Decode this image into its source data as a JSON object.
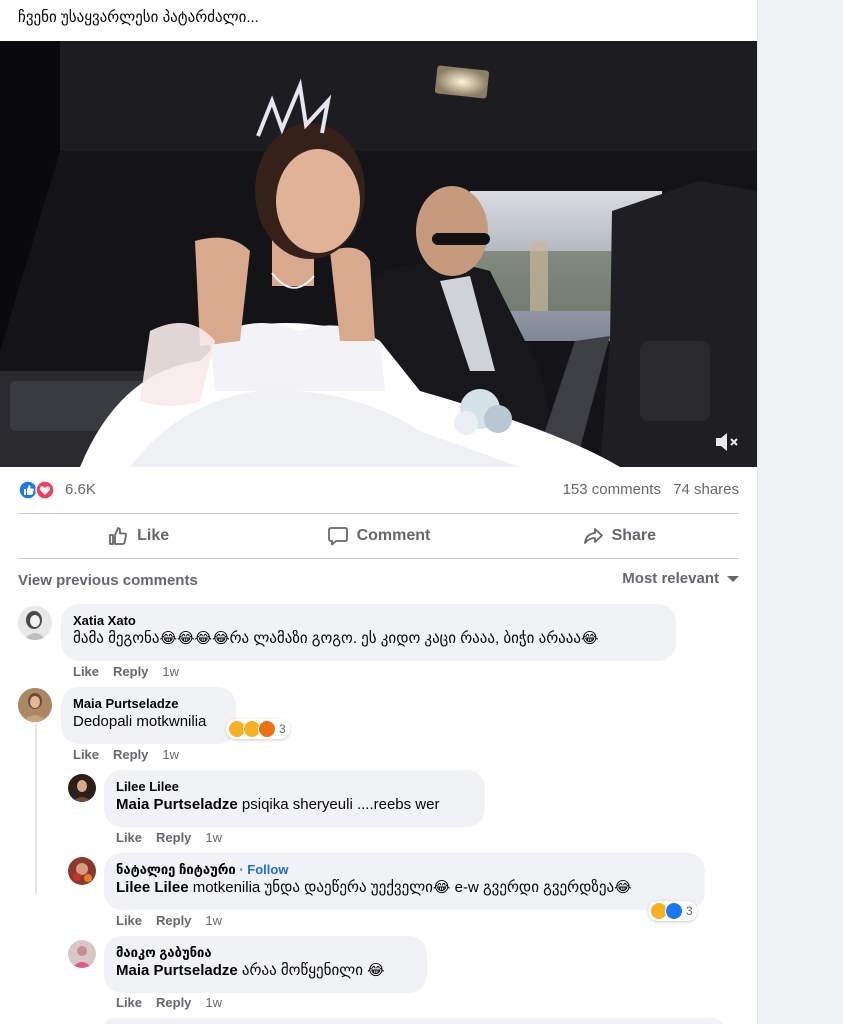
{
  "post": {
    "caption": "ჩვენი უსაყვარლესი პატარძალი..."
  },
  "stats": {
    "reactions_count": "6.6K",
    "comments": "153 comments",
    "shares": "74 shares"
  },
  "actions": {
    "like": "Like",
    "comment": "Comment",
    "share": "Share"
  },
  "comments_header": {
    "view_previous": "View previous comments",
    "sort": "Most relevant"
  },
  "comments": [
    {
      "author": "Xatia Xato",
      "text": "მამა მეგონა😂😂😂😂რა ლამაზი გოგო. ეს კიდო კაცი რააა, ბიჭი არააა😂",
      "like": "Like",
      "reply": "Reply",
      "time": "1w"
    },
    {
      "author": "Maia Purtseladze",
      "text": "Dedopali motkwnilia",
      "reactions": "3",
      "like": "Like",
      "reply": "Reply",
      "time": "1w",
      "replies": [
        {
          "author": "Lilee Lilee",
          "mention": "Maia Purtseladze",
          "text": "psiqika sheryeuli ....reebs wer",
          "like": "Like",
          "reply": "Reply",
          "time": "1w"
        },
        {
          "author": "ნატალიე ჩიტაური",
          "follow": "· Follow",
          "mention": "Lilee Lilee",
          "text": "motkenilia უნდა დაეწერა უექველი😂 e-w გვერდი გვერდზეა😂",
          "reactions": "3",
          "like": "Like",
          "reply": "Reply",
          "time": "1w"
        },
        {
          "author": "მაიკო გაბუნია",
          "mention": "Maia Purtseladze",
          "text": "არაა მოწყენილი 😂",
          "like": "Like",
          "reply": "Reply",
          "time": "1w"
        }
      ]
    }
  ],
  "colors": {
    "like_blue": "#1877f2",
    "love_red": "#f33e58",
    "haha_yellow": "#f7b125",
    "link_blue": "#216fdb",
    "muted_gray": "#65676b",
    "bubble_bg": "#f0f2f5"
  },
  "icons": {
    "like": "thumbs-up-icon",
    "comment": "speech-bubble-icon",
    "share": "share-arrow-icon",
    "mute": "speaker-muted-icon"
  }
}
